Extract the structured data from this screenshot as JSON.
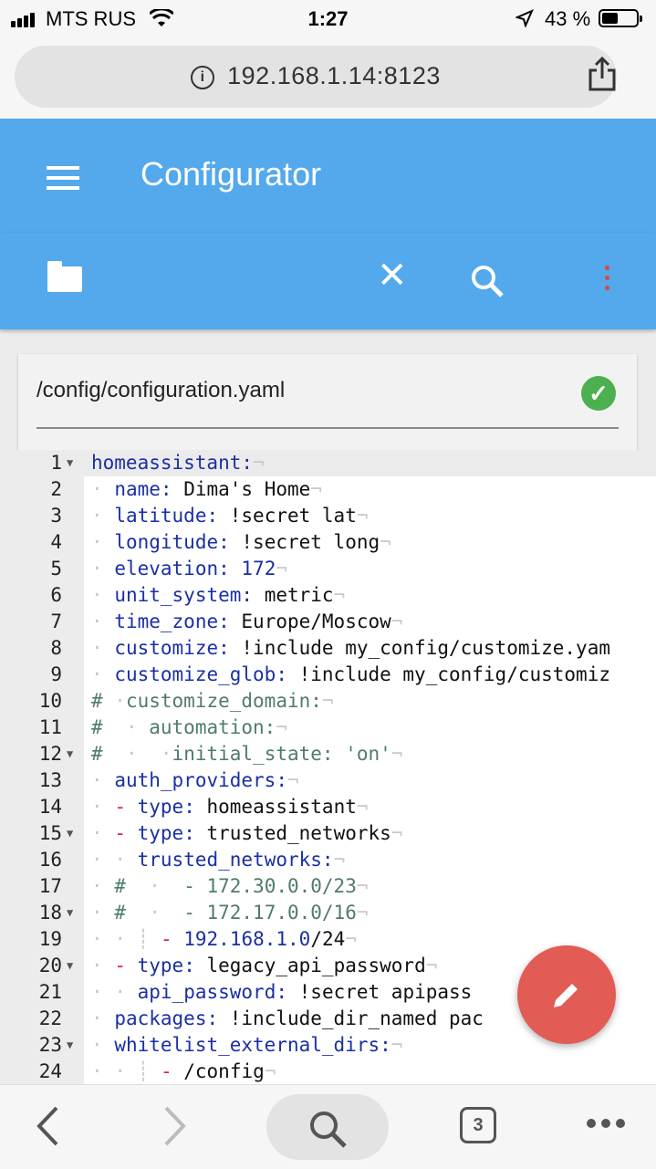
{
  "status_bar": {
    "carrier": "MTS RUS",
    "time": "1:27",
    "battery": "43 %"
  },
  "browser": {
    "url": "192.168.1.14:8123",
    "tab_count": "3"
  },
  "app": {
    "title": "Configurator"
  },
  "file": {
    "path": "/config/configuration.yaml"
  },
  "editor": {
    "lines": [
      {
        "n": "1"
      },
      {
        "n": "2"
      },
      {
        "n": "3"
      },
      {
        "n": "4"
      },
      {
        "n": "5"
      },
      {
        "n": "6"
      },
      {
        "n": "7"
      },
      {
        "n": "8"
      },
      {
        "n": "9"
      },
      {
        "n": "10"
      },
      {
        "n": "11"
      },
      {
        "n": "12"
      },
      {
        "n": "13"
      },
      {
        "n": "14"
      },
      {
        "n": "15"
      },
      {
        "n": "16"
      },
      {
        "n": "17"
      },
      {
        "n": "18"
      },
      {
        "n": "19"
      },
      {
        "n": "20"
      },
      {
        "n": "21"
      },
      {
        "n": "22"
      },
      {
        "n": "23"
      },
      {
        "n": "24"
      }
    ],
    "text": {
      "l1k": "homeassistant:",
      "l2k": "name:",
      "l2v": "Dima's Home",
      "l3k": "latitude:",
      "l3v": "!secret lat",
      "l4k": "longitude:",
      "l4v": "!secret long",
      "l5k": "elevation:",
      "l5v": "172",
      "l6k": "unit_system:",
      "l6v": "metric",
      "l7k": "time_zone:",
      "l7v": "Europe/Moscow",
      "l8k": "customize:",
      "l8v": "!include my_config/customize.yam",
      "l9k": "customize_glob:",
      "l9v": "!include my_config/customiz",
      "l10": "customize_domain:",
      "l11": "automation:",
      "l12k": "initial_state:",
      "l12v": "'on'",
      "l13k": "auth_providers:",
      "l14k": "type:",
      "l14v": "homeassistant",
      "l15k": "type:",
      "l15v": "trusted_networks",
      "l16k": "trusted_networks:",
      "l17": "- 172.30.0.0/23",
      "l18": "- 172.17.0.0/16",
      "l19a": "192.168.1.0",
      "l19b": "/24",
      "l20k": "type:",
      "l20v": "legacy_api_password",
      "l21k": "api_password:",
      "l21v": "!secret apipass",
      "l22k": "packages:",
      "l22v": "!include_dir_named pac",
      "l23k": "whitelist_external_dirs:",
      "l24v": "/config"
    }
  },
  "icons": {
    "hamburger": "menu-icon",
    "folder": "folder-icon",
    "close": "close-icon",
    "search": "search-icon",
    "more": "more-vert-icon",
    "saved": "check-circle-icon",
    "edit": "pencil-icon",
    "share": "share-icon"
  },
  "colors": {
    "primary": "#53a9ec",
    "fab": "#e35b55",
    "success": "#4caf50",
    "key": "#1b2fa5",
    "comment": "#4f7c6a",
    "dash": "#d81b60"
  }
}
